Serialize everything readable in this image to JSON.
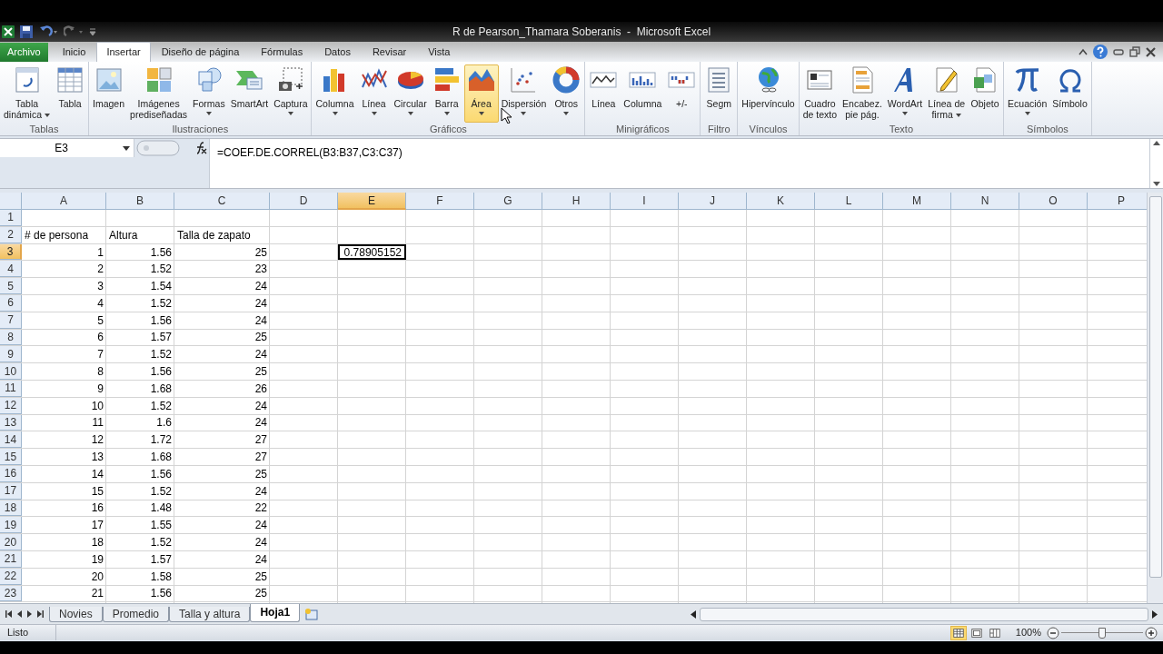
{
  "title_bar": {
    "title": "R de Pearson_Thamara Soberanis  -  Microsoft Excel"
  },
  "ribbon_tabs": [
    {
      "label": "Archivo",
      "kind": "file",
      "selected": false
    },
    {
      "label": "Inicio",
      "kind": "tab",
      "selected": false
    },
    {
      "label": "Insertar",
      "kind": "tab",
      "selected": true
    },
    {
      "label": "Diseño de página",
      "kind": "tab",
      "selected": false
    },
    {
      "label": "Fórmulas",
      "kind": "tab",
      "selected": false
    },
    {
      "label": "Datos",
      "kind": "tab",
      "selected": false
    },
    {
      "label": "Revisar",
      "kind": "tab",
      "selected": false
    },
    {
      "label": "Vista",
      "kind": "tab",
      "selected": false
    }
  ],
  "ribbon_groups": [
    {
      "label": "Tablas",
      "buttons": [
        {
          "label": "Tabla\ndinámica",
          "dropdown": true,
          "highlighted": false
        },
        {
          "label": "Tabla",
          "dropdown": false,
          "highlighted": false
        }
      ]
    },
    {
      "label": "Ilustraciones",
      "buttons": [
        {
          "label": "Imagen",
          "dropdown": false,
          "highlighted": false
        },
        {
          "label": "Imágenes\nprediseñadas",
          "dropdown": false,
          "highlighted": false
        },
        {
          "label": "Formas",
          "dropdown": true,
          "highlighted": false
        },
        {
          "label": "SmartArt",
          "dropdown": false,
          "highlighted": false
        },
        {
          "label": "Captura",
          "dropdown": true,
          "highlighted": false
        }
      ]
    },
    {
      "label": "Gráficos",
      "buttons": [
        {
          "label": "Columna",
          "dropdown": true,
          "highlighted": false
        },
        {
          "label": "Línea",
          "dropdown": true,
          "highlighted": false
        },
        {
          "label": "Circular",
          "dropdown": true,
          "highlighted": false
        },
        {
          "label": "Barra",
          "dropdown": true,
          "highlighted": false
        },
        {
          "label": "Área",
          "dropdown": true,
          "highlighted": true
        },
        {
          "label": "Dispersión",
          "dropdown": true,
          "highlighted": false
        },
        {
          "label": "Otros",
          "dropdown": true,
          "highlighted": false
        }
      ]
    },
    {
      "label": "Minigráficos",
      "buttons": [
        {
          "label": "Línea",
          "dropdown": false,
          "highlighted": false
        },
        {
          "label": "Columna",
          "dropdown": false,
          "highlighted": false
        },
        {
          "label": "+/-",
          "dropdown": false,
          "highlighted": false
        }
      ]
    },
    {
      "label": "Filtro",
      "buttons": [
        {
          "label": "Segm",
          "dropdown": false,
          "highlighted": false
        }
      ]
    },
    {
      "label": "Vínculos",
      "buttons": [
        {
          "label": "Hipervínculo",
          "dropdown": false,
          "highlighted": false
        }
      ]
    },
    {
      "label": "Texto",
      "buttons": [
        {
          "label": "Cuadro\nde texto",
          "dropdown": false,
          "highlighted": false
        },
        {
          "label": "Encabez.\npie pág.",
          "dropdown": false,
          "highlighted": false
        },
        {
          "label": "WordArt",
          "dropdown": true,
          "highlighted": false
        },
        {
          "label": "Línea de\nfirma",
          "dropdown": true,
          "highlighted": false
        },
        {
          "label": "Objeto",
          "dropdown": false,
          "highlighted": false
        }
      ]
    },
    {
      "label": "Símbolos",
      "buttons": [
        {
          "label": "Ecuación",
          "dropdown": true,
          "highlighted": false
        },
        {
          "label": "Símbolo",
          "dropdown": false,
          "highlighted": false
        }
      ]
    }
  ],
  "formula_bar": {
    "name_box": "E3",
    "formula": "=COEF.DE.CORREL(B3:B37,C3:C37)"
  },
  "columns": [
    {
      "label": "A",
      "selected": false
    },
    {
      "label": "B",
      "selected": false
    },
    {
      "label": "C",
      "selected": false
    },
    {
      "label": "D",
      "selected": false
    },
    {
      "label": "E",
      "selected": true
    },
    {
      "label": "F",
      "selected": false
    },
    {
      "label": "G",
      "selected": false
    },
    {
      "label": "H",
      "selected": false
    },
    {
      "label": "I",
      "selected": false
    },
    {
      "label": "J",
      "selected": false
    },
    {
      "label": "K",
      "selected": false
    },
    {
      "label": "L",
      "selected": false
    },
    {
      "label": "M",
      "selected": false
    },
    {
      "label": "N",
      "selected": false
    },
    {
      "label": "O",
      "selected": false
    },
    {
      "label": "P",
      "selected": false
    }
  ],
  "rows": [
    {
      "number": "1",
      "selected": false
    },
    {
      "number": "2",
      "selected": false,
      "cells": {
        "A": {
          "text": "# de persona",
          "kind": "text",
          "selected": false
        },
        "B": {
          "text": "Altura",
          "kind": "text",
          "selected": false
        },
        "C": {
          "text": "Talla de zapato",
          "kind": "text",
          "selected": false
        }
      }
    },
    {
      "number": "3",
      "selected": true,
      "cells": {
        "A": {
          "text": "1",
          "kind": "number",
          "selected": false
        },
        "B": {
          "text": "1.56",
          "kind": "number",
          "selected": false
        },
        "C": {
          "text": "25",
          "kind": "number",
          "selected": false
        },
        "E": {
          "text": "0.78905152",
          "kind": "number",
          "selected": true
        }
      }
    },
    {
      "number": "4",
      "selected": false,
      "cells": {
        "A": {
          "text": "2",
          "kind": "number",
          "selected": false
        },
        "B": {
          "text": "1.52",
          "kind": "number",
          "selected": false
        },
        "C": {
          "text": "23",
          "kind": "number",
          "selected": false
        }
      }
    },
    {
      "number": "5",
      "selected": false,
      "cells": {
        "A": {
          "text": "3",
          "kind": "number",
          "selected": false
        },
        "B": {
          "text": "1.54",
          "kind": "number",
          "selected": false
        },
        "C": {
          "text": "24",
          "kind": "number",
          "selected": false
        }
      }
    },
    {
      "number": "6",
      "selected": false,
      "cells": {
        "A": {
          "text": "4",
          "kind": "number",
          "selected": false
        },
        "B": {
          "text": "1.52",
          "kind": "number",
          "selected": false
        },
        "C": {
          "text": "24",
          "kind": "number",
          "selected": false
        }
      }
    },
    {
      "number": "7",
      "selected": false,
      "cells": {
        "A": {
          "text": "5",
          "kind": "number",
          "selected": false
        },
        "B": {
          "text": "1.56",
          "kind": "number",
          "selected": false
        },
        "C": {
          "text": "24",
          "kind": "number",
          "selected": false
        }
      }
    },
    {
      "number": "8",
      "selected": false,
      "cells": {
        "A": {
          "text": "6",
          "kind": "number",
          "selected": false
        },
        "B": {
          "text": "1.57",
          "kind": "number",
          "selected": false
        },
        "C": {
          "text": "25",
          "kind": "number",
          "selected": false
        }
      }
    },
    {
      "number": "9",
      "selected": false,
      "cells": {
        "A": {
          "text": "7",
          "kind": "number",
          "selected": false
        },
        "B": {
          "text": "1.52",
          "kind": "number",
          "selected": false
        },
        "C": {
          "text": "24",
          "kind": "number",
          "selected": false
        }
      }
    },
    {
      "number": "10",
      "selected": false,
      "cells": {
        "A": {
          "text": "8",
          "kind": "number",
          "selected": false
        },
        "B": {
          "text": "1.56",
          "kind": "number",
          "selected": false
        },
        "C": {
          "text": "25",
          "kind": "number",
          "selected": false
        }
      }
    },
    {
      "number": "11",
      "selected": false,
      "cells": {
        "A": {
          "text": "9",
          "kind": "number",
          "selected": false
        },
        "B": {
          "text": "1.68",
          "kind": "number",
          "selected": false
        },
        "C": {
          "text": "26",
          "kind": "number",
          "selected": false
        }
      }
    },
    {
      "number": "12",
      "selected": false,
      "cells": {
        "A": {
          "text": "10",
          "kind": "number",
          "selected": false
        },
        "B": {
          "text": "1.52",
          "kind": "number",
          "selected": false
        },
        "C": {
          "text": "24",
          "kind": "number",
          "selected": false
        }
      }
    },
    {
      "number": "13",
      "selected": false,
      "cells": {
        "A": {
          "text": "11",
          "kind": "number",
          "selected": false
        },
        "B": {
          "text": "1.6",
          "kind": "number",
          "selected": false
        },
        "C": {
          "text": "24",
          "kind": "number",
          "selected": false
        }
      }
    },
    {
      "number": "14",
      "selected": false,
      "cells": {
        "A": {
          "text": "12",
          "kind": "number",
          "selected": false
        },
        "B": {
          "text": "1.72",
          "kind": "number",
          "selected": false
        },
        "C": {
          "text": "27",
          "kind": "number",
          "selected": false
        }
      }
    },
    {
      "number": "15",
      "selected": false,
      "cells": {
        "A": {
          "text": "13",
          "kind": "number",
          "selected": false
        },
        "B": {
          "text": "1.68",
          "kind": "number",
          "selected": false
        },
        "C": {
          "text": "27",
          "kind": "number",
          "selected": false
        }
      }
    },
    {
      "number": "16",
      "selected": false,
      "cells": {
        "A": {
          "text": "14",
          "kind": "number",
          "selected": false
        },
        "B": {
          "text": "1.56",
          "kind": "number",
          "selected": false
        },
        "C": {
          "text": "25",
          "kind": "number",
          "selected": false
        }
      }
    },
    {
      "number": "17",
      "selected": false,
      "cells": {
        "A": {
          "text": "15",
          "kind": "number",
          "selected": false
        },
        "B": {
          "text": "1.52",
          "kind": "number",
          "selected": false
        },
        "C": {
          "text": "24",
          "kind": "number",
          "selected": false
        }
      }
    },
    {
      "number": "18",
      "selected": false,
      "cells": {
        "A": {
          "text": "16",
          "kind": "number",
          "selected": false
        },
        "B": {
          "text": "1.48",
          "kind": "number",
          "selected": false
        },
        "C": {
          "text": "22",
          "kind": "number",
          "selected": false
        }
      }
    },
    {
      "number": "19",
      "selected": false,
      "cells": {
        "A": {
          "text": "17",
          "kind": "number",
          "selected": false
        },
        "B": {
          "text": "1.55",
          "kind": "number",
          "selected": false
        },
        "C": {
          "text": "24",
          "kind": "number",
          "selected": false
        }
      }
    },
    {
      "number": "20",
      "selected": false,
      "cells": {
        "A": {
          "text": "18",
          "kind": "number",
          "selected": false
        },
        "B": {
          "text": "1.52",
          "kind": "number",
          "selected": false
        },
        "C": {
          "text": "24",
          "kind": "number",
          "selected": false
        }
      }
    },
    {
      "number": "21",
      "selected": false,
      "cells": {
        "A": {
          "text": "19",
          "kind": "number",
          "selected": false
        },
        "B": {
          "text": "1.57",
          "kind": "number",
          "selected": false
        },
        "C": {
          "text": "24",
          "kind": "number",
          "selected": false
        }
      }
    },
    {
      "number": "22",
      "selected": false,
      "cells": {
        "A": {
          "text": "20",
          "kind": "number",
          "selected": false
        },
        "B": {
          "text": "1.58",
          "kind": "number",
          "selected": false
        },
        "C": {
          "text": "25",
          "kind": "number",
          "selected": false
        }
      }
    },
    {
      "number": "23",
      "selected": false,
      "cells": {
        "A": {
          "text": "21",
          "kind": "number",
          "selected": false
        },
        "B": {
          "text": "1.56",
          "kind": "number",
          "selected": false
        },
        "C": {
          "text": "25",
          "kind": "number",
          "selected": false
        }
      }
    }
  ],
  "sheet_tabs": [
    {
      "label": "Novies",
      "selected": false
    },
    {
      "label": "Promedio",
      "selected": false
    },
    {
      "label": "Talla y altura",
      "selected": false
    },
    {
      "label": "Hoja1",
      "selected": true
    }
  ],
  "status_bar": {
    "status": "Listo",
    "view_buttons": [
      {
        "kind": "normal",
        "selected": true
      },
      {
        "kind": "layout",
        "selected": false
      },
      {
        "kind": "pagebreak",
        "selected": false
      }
    ],
    "zoom": "100%",
    "zoom_slider": {
      "level": 0.5
    }
  }
}
